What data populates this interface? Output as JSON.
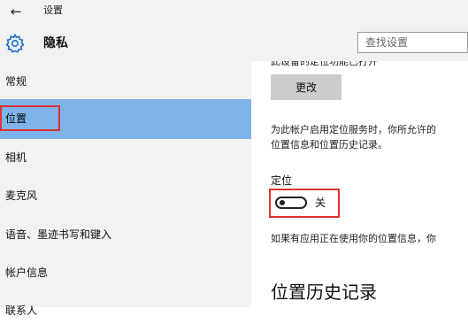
{
  "window": {
    "title": "设置",
    "back_icon": "back-arrow-icon"
  },
  "header": {
    "page_title": "隐私",
    "icon": "gear-icon"
  },
  "search": {
    "placeholder": "查找设置",
    "value": ""
  },
  "sidebar": {
    "selected_color": "#7eb4ea",
    "highlight_color": "#e0312b",
    "items": [
      {
        "label": "常规",
        "selected": false
      },
      {
        "label": "位置",
        "selected": true
      },
      {
        "label": "相机",
        "selected": false
      },
      {
        "label": "麦克风",
        "selected": false
      },
      {
        "label": "语音、墨迹书写和键入",
        "selected": false
      },
      {
        "label": "帐户信息",
        "selected": false
      },
      {
        "label": "联系人",
        "selected": false
      }
    ]
  },
  "content": {
    "cut_text": "此设备的定位功能已打开",
    "change_button": "更改",
    "desc_line1": "为此帐户启用定位服务时，你所允许的",
    "desc_line2": "位置信息和位置历史记录。",
    "toggle_label": "定位",
    "toggle_state": "关",
    "desc2": "如果有应用正在使用你的位置信息，你",
    "section_heading": "位置历史记录"
  }
}
